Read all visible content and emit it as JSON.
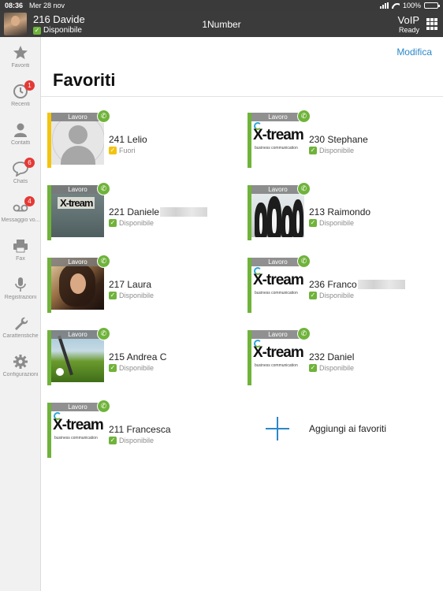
{
  "status_bar": {
    "time": "08:36",
    "date": "Mer 28 nov",
    "battery": "100%"
  },
  "header": {
    "user_name": "216 Davide",
    "user_status": "Disponibile",
    "app_title": "1Number",
    "voip_label": "VoIP",
    "voip_status": "Ready"
  },
  "sidebar": {
    "items": [
      {
        "label": "Favoriti",
        "icon": "star-icon"
      },
      {
        "label": "Recenti",
        "icon": "clock-icon",
        "badge": "1"
      },
      {
        "label": "Contatti",
        "icon": "person-icon"
      },
      {
        "label": "Chats",
        "icon": "chat-bubble-icon",
        "badge": "6"
      },
      {
        "label": "Messaggio vo...",
        "icon": "voicemail-icon",
        "badge": "4"
      },
      {
        "label": "Fax",
        "icon": "printer-icon"
      },
      {
        "label": "Registrazioni",
        "icon": "microphone-icon"
      },
      {
        "label": "Caratteristiche",
        "icon": "wrench-icon"
      },
      {
        "label": "Configurazioni",
        "icon": "gear-icon"
      }
    ]
  },
  "main": {
    "edit_label": "Modifica",
    "title": "Favoriti",
    "work_label": "Lavoro",
    "favorites": [
      {
        "name": "241 Lelio",
        "status": "Fuori",
        "status_kind": "away",
        "picture": "default-avatar"
      },
      {
        "name": "230 Stephane",
        "status": "Disponibile",
        "status_kind": "available",
        "picture": "xtream-logo"
      },
      {
        "name": "221 Daniele",
        "status": "Disponibile",
        "status_kind": "available",
        "picture": "xtream-strip",
        "name_blurred": true
      },
      {
        "name": "213 Raimondo",
        "status": "Disponibile",
        "status_kind": "available",
        "picture": "penguins-photo"
      },
      {
        "name": "217 Laura",
        "status": "Disponibile",
        "status_kind": "available",
        "picture": "woman-photo"
      },
      {
        "name": "236 Franco",
        "status": "Disponibile",
        "status_kind": "available",
        "picture": "xtream-logo",
        "name_blurred": true
      },
      {
        "name": "215 Andrea C",
        "status": "Disponibile",
        "status_kind": "available",
        "picture": "golf-photo"
      },
      {
        "name": "232 Daniel",
        "status": "Disponibile",
        "status_kind": "available",
        "picture": "xtream-logo"
      },
      {
        "name": "211 Francesca",
        "status": "Disponibile",
        "status_kind": "available",
        "picture": "xtream-logo"
      }
    ],
    "add_label": "Aggiungi ai favoriti",
    "logo_text": "X-tream",
    "logo_sub": "business communication",
    "colors": {
      "accent": "#2b88c9",
      "available": "#6fb33a",
      "away": "#f2c40e",
      "badge": "#e53935"
    }
  }
}
